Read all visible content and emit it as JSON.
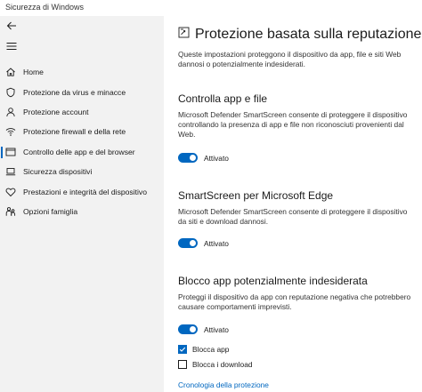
{
  "window": {
    "title": "Sicurezza di Windows"
  },
  "sidebar": {
    "items": [
      {
        "label": "Home",
        "icon": "home-icon"
      },
      {
        "label": "Protezione da virus e minacce",
        "icon": "shield-icon"
      },
      {
        "label": "Protezione account",
        "icon": "person-icon"
      },
      {
        "label": "Protezione firewall e della rete",
        "icon": "wifi-icon"
      },
      {
        "label": "Controllo delle app e del browser",
        "icon": "app-browser-icon",
        "active": true
      },
      {
        "label": "Sicurezza dispositivi",
        "icon": "laptop-icon"
      },
      {
        "label": "Prestazioni e integrità del dispositivo",
        "icon": "heart-icon"
      },
      {
        "label": "Opzioni famiglia",
        "icon": "family-icon"
      }
    ]
  },
  "main": {
    "title": "Protezione basata sulla reputazione",
    "description": "Queste impostazioni proteggono il dispositivo da app, file e siti Web dannosi o potenzialmente indesiderati.",
    "sections": [
      {
        "title": "Controlla app e file",
        "text": "Microsoft Defender SmartScreen consente di proteggere il dispositivo controllando la presenza di app e file non riconosciuti provenienti dal Web.",
        "toggle_label": "Attivato"
      },
      {
        "title": "SmartScreen per Microsoft Edge",
        "text": "Microsoft Defender SmartScreen consente di proteggere il dispositivo da siti e download dannosi.",
        "toggle_label": "Attivato"
      },
      {
        "title": "Blocco app potenzialmente indesiderata",
        "text": "Proteggi il dispositivo da app con reputazione negativa che potrebbero causare comportamenti imprevisti.",
        "toggle_label": "Attivato",
        "checkboxes": [
          {
            "label": "Blocca app",
            "checked": true
          },
          {
            "label": "Blocca i download",
            "checked": false
          }
        ]
      }
    ],
    "history_link": "Cronologia della protezione"
  },
  "colors": {
    "accent": "#0067c0",
    "sidebar_bg": "#f2f2f2"
  }
}
